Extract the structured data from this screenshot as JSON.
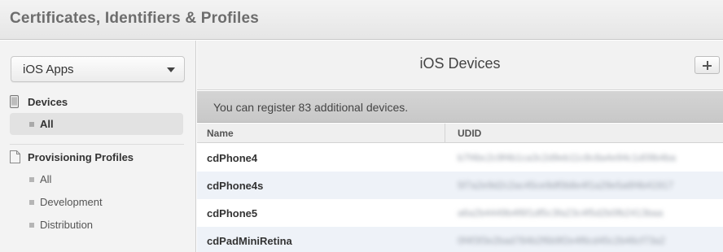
{
  "header": {
    "title": "Certificates, Identifiers & Profiles"
  },
  "sidebar": {
    "platform_select": {
      "value": "iOS Apps"
    },
    "sections": [
      {
        "title": "Devices",
        "icon": "device-icon",
        "items": [
          {
            "label": "All",
            "active": true
          }
        ]
      },
      {
        "title": "Provisioning Profiles",
        "icon": "document-icon",
        "items": [
          {
            "label": "All"
          },
          {
            "label": "Development"
          },
          {
            "label": "Distribution"
          }
        ]
      }
    ]
  },
  "main": {
    "title": "iOS Devices",
    "add_button": {
      "icon": "plus-icon"
    },
    "notice": "You can register 83 additional devices.",
    "table": {
      "columns": [
        "Name",
        "UDID"
      ],
      "rows": [
        {
          "name": "cdPhone4",
          "udid": "b7f4bc2c9f4b1ca3c2d9eb11c8c8a4e94c1d09b4ba"
        },
        {
          "name": "cdPhone4s",
          "udid": "5f7a2e9d2c2ac45ce9df0b8e4f1a29e5a6f4b41917"
        },
        {
          "name": "cdPhone5",
          "udid": "a6a2b4449b4f6f1df5c3fa23c4f5d2b0fb2413baa"
        },
        {
          "name": "cdPadMiniRetina",
          "udid": "0f4f3f3e2bad784b2f6b9f2e4f6cd45c2b46cf73a2"
        }
      ]
    }
  }
}
